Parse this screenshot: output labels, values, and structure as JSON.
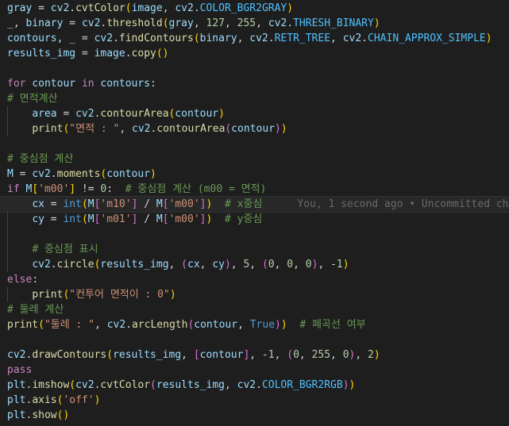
{
  "editor": {
    "background": "#1e1e1e",
    "current_line": 13,
    "blame_annotation": "You, 1 second ago • Uncommitted ch",
    "lines": [
      [
        [
          "var",
          "gray"
        ],
        [
          "op",
          " = "
        ],
        [
          "var",
          "cv2"
        ],
        [
          "op",
          "."
        ],
        [
          "fn",
          "cvtColor"
        ],
        [
          "b1",
          "("
        ],
        [
          "var",
          "image"
        ],
        [
          "op",
          ", "
        ],
        [
          "var",
          "cv2"
        ],
        [
          "op",
          "."
        ],
        [
          "con",
          "COLOR_BGR2GRAY"
        ],
        [
          "b1",
          ")"
        ]
      ],
      [
        [
          "var",
          "_"
        ],
        [
          "op",
          ", "
        ],
        [
          "var",
          "binary"
        ],
        [
          "op",
          " = "
        ],
        [
          "var",
          "cv2"
        ],
        [
          "op",
          "."
        ],
        [
          "fn",
          "threshold"
        ],
        [
          "b1",
          "("
        ],
        [
          "var",
          "gray"
        ],
        [
          "op",
          ", "
        ],
        [
          "num",
          "127"
        ],
        [
          "op",
          ", "
        ],
        [
          "num",
          "255"
        ],
        [
          "op",
          ", "
        ],
        [
          "var",
          "cv2"
        ],
        [
          "op",
          "."
        ],
        [
          "con",
          "THRESH_BINARY"
        ],
        [
          "b1",
          ")"
        ]
      ],
      [
        [
          "var",
          "contours"
        ],
        [
          "op",
          ", "
        ],
        [
          "var",
          "_"
        ],
        [
          "op",
          " = "
        ],
        [
          "var",
          "cv2"
        ],
        [
          "op",
          "."
        ],
        [
          "fn",
          "findContours"
        ],
        [
          "b1",
          "("
        ],
        [
          "var",
          "binary"
        ],
        [
          "op",
          ", "
        ],
        [
          "var",
          "cv2"
        ],
        [
          "op",
          "."
        ],
        [
          "con",
          "RETR_TREE"
        ],
        [
          "op",
          ", "
        ],
        [
          "var",
          "cv2"
        ],
        [
          "op",
          "."
        ],
        [
          "con",
          "CHAIN_APPROX_SIMPLE"
        ],
        [
          "b1",
          ")"
        ]
      ],
      [
        [
          "var",
          "results_img"
        ],
        [
          "op",
          " = "
        ],
        [
          "var",
          "image"
        ],
        [
          "op",
          "."
        ],
        [
          "fn",
          "copy"
        ],
        [
          "b1",
          "()"
        ]
      ],
      [],
      [
        [
          "kw",
          "for"
        ],
        [
          "op",
          " "
        ],
        [
          "var",
          "contour"
        ],
        [
          "op",
          " "
        ],
        [
          "kw",
          "in"
        ],
        [
          "op",
          " "
        ],
        [
          "var",
          "contours"
        ],
        [
          "op",
          ":"
        ]
      ],
      [
        [
          "cmt",
          "# 면적계산"
        ]
      ],
      [
        [
          "pl",
          "    "
        ],
        [
          "var",
          "area"
        ],
        [
          "op",
          " = "
        ],
        [
          "var",
          "cv2"
        ],
        [
          "op",
          "."
        ],
        [
          "fn",
          "contourArea"
        ],
        [
          "b1",
          "("
        ],
        [
          "var",
          "contour"
        ],
        [
          "b1",
          ")"
        ]
      ],
      [
        [
          "pl",
          "    "
        ],
        [
          "fn",
          "print"
        ],
        [
          "b1",
          "("
        ],
        [
          "str",
          "\"면적 : \""
        ],
        [
          "op",
          ", "
        ],
        [
          "var",
          "cv2"
        ],
        [
          "op",
          "."
        ],
        [
          "fn",
          "contourArea"
        ],
        [
          "b2",
          "("
        ],
        [
          "var",
          "contour"
        ],
        [
          "b2",
          ")"
        ],
        [
          "b1",
          ")"
        ]
      ],
      [],
      [
        [
          "cmt",
          "# 중심점 계산"
        ]
      ],
      [
        [
          "var",
          "M"
        ],
        [
          "op",
          " = "
        ],
        [
          "var",
          "cv2"
        ],
        [
          "op",
          "."
        ],
        [
          "fn",
          "moments"
        ],
        [
          "b1",
          "("
        ],
        [
          "var",
          "contour"
        ],
        [
          "b1",
          ")"
        ]
      ],
      [
        [
          "kw",
          "if"
        ],
        [
          "op",
          " "
        ],
        [
          "var",
          "M"
        ],
        [
          "b1",
          "["
        ],
        [
          "str",
          "'m00'"
        ],
        [
          "b1",
          "]"
        ],
        [
          "op",
          " != "
        ],
        [
          "num",
          "0"
        ],
        [
          "op",
          ":  "
        ],
        [
          "cmt",
          "# 중심점 계산 (m00 = 면적)"
        ]
      ],
      [
        [
          "pl",
          "    "
        ],
        [
          "var",
          "cx"
        ],
        [
          "op",
          " = "
        ],
        [
          "bi",
          "int"
        ],
        [
          "b1",
          "("
        ],
        [
          "var",
          "M"
        ],
        [
          "b2",
          "["
        ],
        [
          "str",
          "'m10'"
        ],
        [
          "b2",
          "]"
        ],
        [
          "op",
          " / "
        ],
        [
          "var",
          "M"
        ],
        [
          "b2",
          "["
        ],
        [
          "str",
          "'m00'"
        ],
        [
          "b2",
          "]"
        ],
        [
          "b1",
          ")"
        ],
        [
          "op",
          "  "
        ],
        [
          "cmt",
          "# x중심"
        ]
      ],
      [
        [
          "pl",
          "    "
        ],
        [
          "var",
          "cy"
        ],
        [
          "op",
          " = "
        ],
        [
          "bi",
          "int"
        ],
        [
          "b1",
          "("
        ],
        [
          "var",
          "M"
        ],
        [
          "b2",
          "["
        ],
        [
          "str",
          "'m01'"
        ],
        [
          "b2",
          "]"
        ],
        [
          "op",
          " / "
        ],
        [
          "var",
          "M"
        ],
        [
          "b2",
          "["
        ],
        [
          "str",
          "'m00'"
        ],
        [
          "b2",
          "]"
        ],
        [
          "b1",
          ")"
        ],
        [
          "op",
          "  "
        ],
        [
          "cmt",
          "# y중심"
        ]
      ],
      [],
      [
        [
          "pl",
          "    "
        ],
        [
          "cmt",
          "# 중심점 표시"
        ]
      ],
      [
        [
          "pl",
          "    "
        ],
        [
          "var",
          "cv2"
        ],
        [
          "op",
          "."
        ],
        [
          "fn",
          "circle"
        ],
        [
          "b1",
          "("
        ],
        [
          "var",
          "results_img"
        ],
        [
          "op",
          ", "
        ],
        [
          "b2",
          "("
        ],
        [
          "var",
          "cx"
        ],
        [
          "op",
          ", "
        ],
        [
          "var",
          "cy"
        ],
        [
          "b2",
          ")"
        ],
        [
          "op",
          ", "
        ],
        [
          "num",
          "5"
        ],
        [
          "op",
          ", "
        ],
        [
          "b2",
          "("
        ],
        [
          "num",
          "0"
        ],
        [
          "op",
          ", "
        ],
        [
          "num",
          "0"
        ],
        [
          "op",
          ", "
        ],
        [
          "num",
          "0"
        ],
        [
          "b2",
          ")"
        ],
        [
          "op",
          ", "
        ],
        [
          "op",
          "-"
        ],
        [
          "num",
          "1"
        ],
        [
          "b1",
          ")"
        ]
      ],
      [
        [
          "kw",
          "else"
        ],
        [
          "op",
          ":"
        ]
      ],
      [
        [
          "pl",
          "    "
        ],
        [
          "fn",
          "print"
        ],
        [
          "b1",
          "("
        ],
        [
          "str",
          "\"컨투어 면적이 : 0\""
        ],
        [
          "b1",
          ")"
        ]
      ],
      [
        [
          "cmt",
          "# 둘레 계산"
        ]
      ],
      [
        [
          "fn",
          "print"
        ],
        [
          "b1",
          "("
        ],
        [
          "str",
          "\"둘레 : \""
        ],
        [
          "op",
          ", "
        ],
        [
          "var",
          "cv2"
        ],
        [
          "op",
          "."
        ],
        [
          "fn",
          "arcLength"
        ],
        [
          "b2",
          "("
        ],
        [
          "var",
          "contour"
        ],
        [
          "op",
          ", "
        ],
        [
          "bi",
          "True"
        ],
        [
          "b2",
          ")"
        ],
        [
          "b1",
          ")"
        ],
        [
          "op",
          "  "
        ],
        [
          "cmt",
          "# 폐곡선 여부"
        ]
      ],
      [],
      [
        [
          "var",
          "cv2"
        ],
        [
          "op",
          "."
        ],
        [
          "fn",
          "drawContours"
        ],
        [
          "b1",
          "("
        ],
        [
          "var",
          "results_img"
        ],
        [
          "op",
          ", "
        ],
        [
          "b2",
          "["
        ],
        [
          "var",
          "contour"
        ],
        [
          "b2",
          "]"
        ],
        [
          "op",
          ", "
        ],
        [
          "op",
          "-"
        ],
        [
          "num",
          "1"
        ],
        [
          "op",
          ", "
        ],
        [
          "b2",
          "("
        ],
        [
          "num",
          "0"
        ],
        [
          "op",
          ", "
        ],
        [
          "num",
          "255"
        ],
        [
          "op",
          ", "
        ],
        [
          "num",
          "0"
        ],
        [
          "b2",
          ")"
        ],
        [
          "op",
          ", "
        ],
        [
          "num",
          "2"
        ],
        [
          "b1",
          ")"
        ]
      ],
      [
        [
          "kw",
          "pass"
        ]
      ],
      [
        [
          "var",
          "plt"
        ],
        [
          "op",
          "."
        ],
        [
          "fn",
          "imshow"
        ],
        [
          "b1",
          "("
        ],
        [
          "var",
          "cv2"
        ],
        [
          "op",
          "."
        ],
        [
          "fn",
          "cvtColor"
        ],
        [
          "b2",
          "("
        ],
        [
          "var",
          "results_img"
        ],
        [
          "op",
          ", "
        ],
        [
          "var",
          "cv2"
        ],
        [
          "op",
          "."
        ],
        [
          "con",
          "COLOR_BGR2RGB"
        ],
        [
          "b2",
          ")"
        ],
        [
          "b1",
          ")"
        ]
      ],
      [
        [
          "var",
          "plt"
        ],
        [
          "op",
          "."
        ],
        [
          "fn",
          "axis"
        ],
        [
          "b1",
          "("
        ],
        [
          "str",
          "'off'"
        ],
        [
          "b1",
          ")"
        ]
      ],
      [
        [
          "var",
          "plt"
        ],
        [
          "op",
          "."
        ],
        [
          "fn",
          "show"
        ],
        [
          "b1",
          "()"
        ]
      ]
    ]
  }
}
